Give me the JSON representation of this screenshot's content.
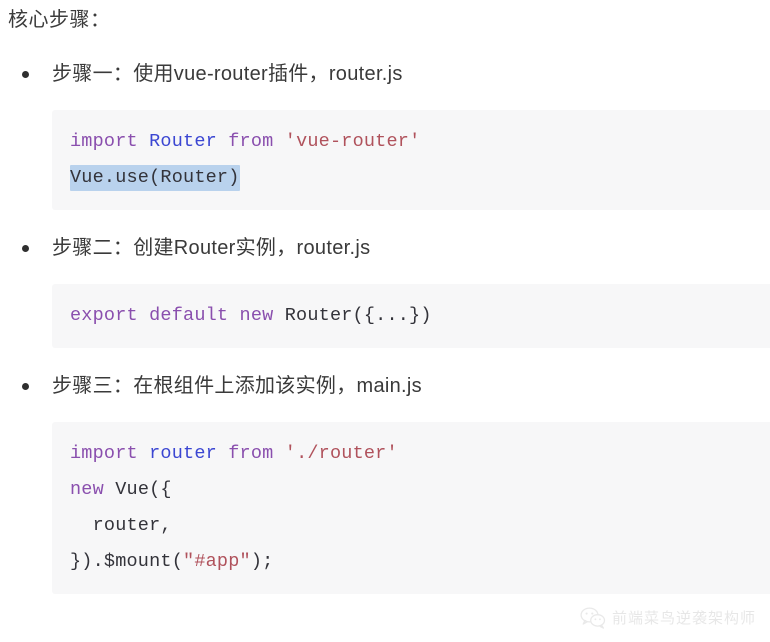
{
  "page": {
    "background_color": "#ffffff",
    "heading": "核心步骤："
  },
  "theme": {
    "text_color": "#3a3a3a",
    "code_bg": "#f7f7f8",
    "code_text": "#34343a",
    "keyword_color": "#8a4fae",
    "identifier_color": "#3b46d2",
    "string_color": "#b0525c",
    "selection_highlight": "#b9d2ed",
    "bullet_color": "#2f2f2f",
    "watermark_color": "#c7c7c7"
  },
  "steps": [
    {
      "bullet": "•",
      "label": "步骤一：使用vue-router插件，router.js",
      "code_lines": [
        {
          "tokens": [
            {
              "text": "import ",
              "type": "keyword"
            },
            {
              "text": "Router ",
              "type": "identifier"
            },
            {
              "text": "from ",
              "type": "keyword"
            },
            {
              "text": "'vue-router'",
              "type": "string"
            }
          ],
          "highlighted": false
        },
        {
          "tokens": [
            {
              "text": "Vue.use(Router)",
              "type": "plain"
            }
          ],
          "highlighted": true
        }
      ]
    },
    {
      "bullet": "•",
      "label": "步骤二：创建Router实例，router.js",
      "code_lines": [
        {
          "tokens": [
            {
              "text": "export default new ",
              "type": "keyword"
            },
            {
              "text": "Router({...})",
              "type": "plain"
            }
          ],
          "highlighted": false
        }
      ]
    },
    {
      "bullet": "•",
      "label": "步骤三：在根组件上添加该实例，main.js",
      "code_lines": [
        {
          "tokens": [
            {
              "text": "import ",
              "type": "keyword"
            },
            {
              "text": "router ",
              "type": "identifier"
            },
            {
              "text": "from ",
              "type": "keyword"
            },
            {
              "text": "'./router'",
              "type": "string"
            }
          ],
          "highlighted": false
        },
        {
          "tokens": [
            {
              "text": "new ",
              "type": "keyword"
            },
            {
              "text": "Vue({",
              "type": "plain"
            }
          ],
          "highlighted": false
        },
        {
          "tokens": [
            {
              "text": "  router,",
              "type": "plain"
            }
          ],
          "highlighted": false
        },
        {
          "tokens": [
            {
              "text": "}).$mount(",
              "type": "plain"
            },
            {
              "text": "\"#app\"",
              "type": "string"
            },
            {
              "text": ");",
              "type": "plain"
            }
          ],
          "highlighted": false
        }
      ]
    }
  ],
  "watermark": {
    "icon": "wechat-icon",
    "text": "前端菜鸟逆袭架构师"
  }
}
